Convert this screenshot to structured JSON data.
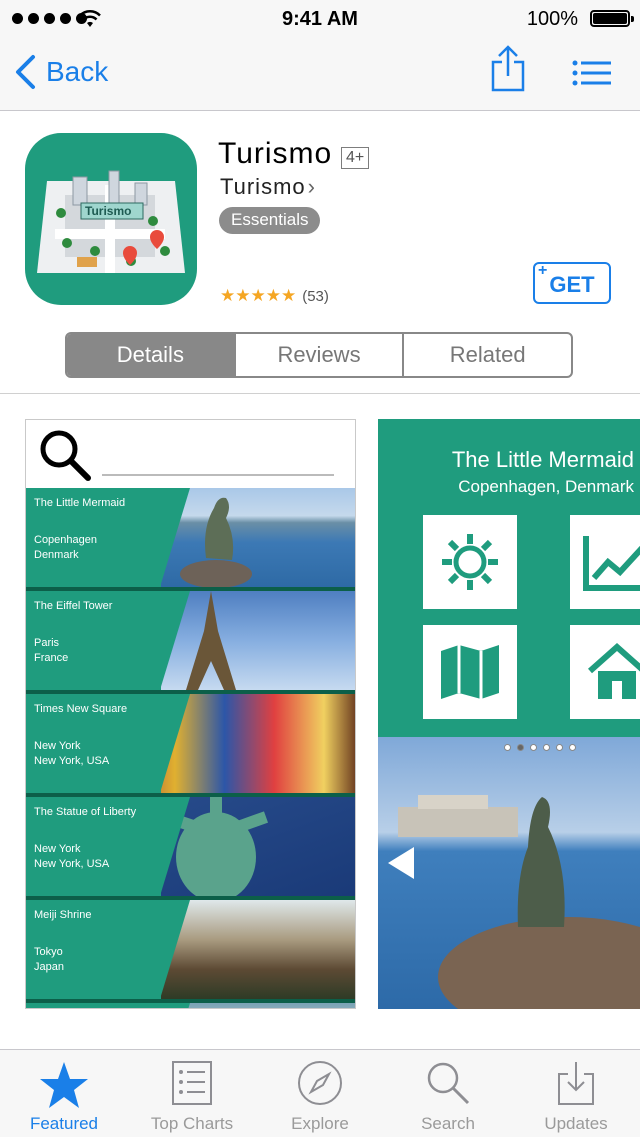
{
  "status_bar": {
    "time": "9:41 AM",
    "battery": "100%"
  },
  "nav": {
    "back_label": "Back"
  },
  "app": {
    "title": "Turismo",
    "age_rating": "4+",
    "developer": "Turismo",
    "category": "Essentials",
    "rating_stars": "★★★★★",
    "rating_count": "(53)",
    "get_label": "GET",
    "icon_text": "Turismo"
  },
  "segments": [
    "Details",
    "Reviews",
    "Related"
  ],
  "screenshot1": {
    "rows": [
      {
        "name": "The Little Mermaid",
        "line1": "Copenhagen",
        "line2": "Denmark"
      },
      {
        "name": "The Eiffel Tower",
        "line1": "Paris",
        "line2": "France"
      },
      {
        "name": "Times New Square",
        "line1": "New York",
        "line2": "New York, USA"
      },
      {
        "name": "The Statue of Liberty",
        "line1": "New York",
        "line2": "New York, USA"
      },
      {
        "name": "Meiji Shrine",
        "line1": "Tokyo",
        "line2": "Japan"
      }
    ]
  },
  "screenshot2": {
    "title": "The Little Mermaid",
    "subtitle": "Copenhagen, Denmark"
  },
  "tabs": [
    "Featured",
    "Top Charts",
    "Explore",
    "Search",
    "Updates"
  ],
  "colors": {
    "accent": "#1a7fe8",
    "brand_green": "#1f9c7e",
    "star": "#f5a623"
  }
}
